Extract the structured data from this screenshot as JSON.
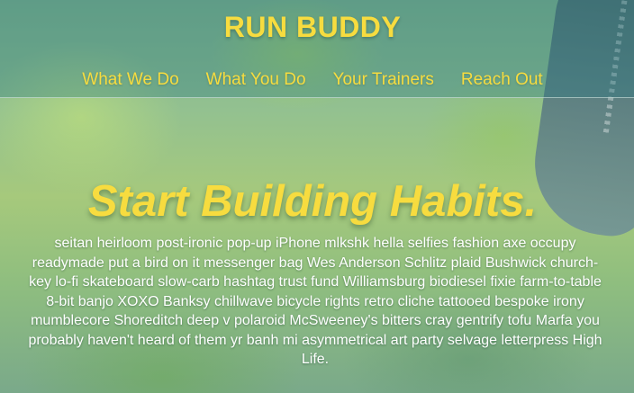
{
  "header": {
    "brand": "RUN BUDDY",
    "nav": [
      {
        "label": "What We Do"
      },
      {
        "label": "What You Do"
      },
      {
        "label": "Your Trainers"
      },
      {
        "label": "Reach Out"
      }
    ]
  },
  "hero": {
    "title": "Start Building Habits.",
    "body": "seitan heirloom post-ironic pop-up iPhone mlkshk hella selfies fashion axe occupy readymade put a bird on it messenger bag Wes Anderson Schlitz plaid Bushwick church-key lo-fi skateboard slow-carb hashtag trust fund Williamsburg biodiesel fixie farm-to-table 8-bit banjo XOXO Banksy chillwave bicycle rights retro cliche tattooed bespoke irony mumblecore Shoreditch deep v polaroid McSweeney's bitters cray gentrify tofu Marfa you probably haven't heard of them yr banh mi asymmetrical art party selvage letterpress High Life."
  },
  "colors": {
    "accent": "#f7dc3f",
    "header_overlay": "#28788a",
    "body_text": "#ffffff"
  }
}
